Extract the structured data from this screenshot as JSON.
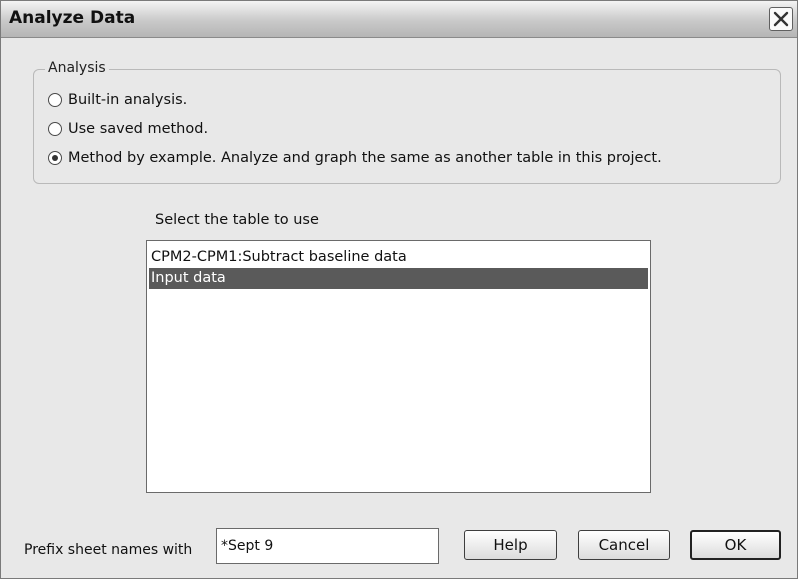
{
  "window": {
    "title": "Analyze Data",
    "close_icon": "close-icon"
  },
  "analysis": {
    "legend": "Analysis",
    "options": [
      {
        "label": "Built-in analysis.",
        "checked": false
      },
      {
        "label": "Use saved method.",
        "checked": false
      },
      {
        "label": "Method by example. Analyze and graph the same as another table in this project.",
        "checked": true
      }
    ]
  },
  "table_select": {
    "caption": "Select the table to use",
    "items": [
      {
        "label": "CPM2-CPM1:Subtract baseline data",
        "selected": false
      },
      {
        "label": "Input data",
        "selected": true
      }
    ]
  },
  "footer": {
    "prefix_label": "Prefix sheet names with",
    "prefix_value": "*Sept 9",
    "help_label": "Help",
    "cancel_label": "Cancel",
    "ok_label": "OK"
  },
  "colors": {
    "selection": "#5a5a5a",
    "dialog_bg": "#e8e8e8"
  }
}
